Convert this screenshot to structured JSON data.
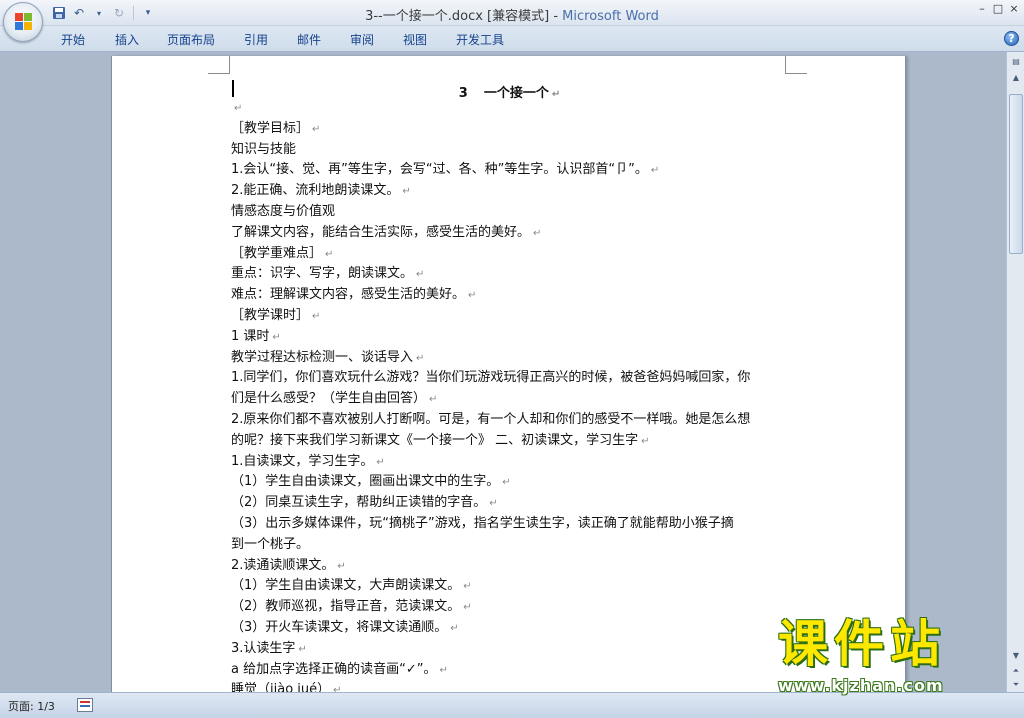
{
  "window": {
    "title_doc": "3--一个接一个.docx [兼容模式] -",
    "title_app": "Microsoft Word",
    "controls": [
      "–",
      "□",
      "×"
    ]
  },
  "quick_access": {
    "icons": [
      "save-icon",
      "undo-icon",
      "redo-icon",
      "customize-icon"
    ]
  },
  "ribbon": {
    "tabs": [
      "开始",
      "插入",
      "页面布局",
      "引用",
      "邮件",
      "审阅",
      "视图",
      "开发工具"
    ],
    "help": "?"
  },
  "document": {
    "title_num": "3",
    "title_text": "一个接一个",
    "pilcrow": "↵",
    "lines": [
      "",
      "［教学目标］",
      "知识与技能",
      "1.会认“接、觉、再”等生字，会写“过、各、种”等生字。认识部首“卩”。",
      "2.能正确、流利地朗读课文。",
      "情感态度与价值观",
      "了解课文内容，能结合生活实际，感受生活的美好。",
      "［教学重难点］",
      "重点：识字、写字，朗读课文。",
      "难点：理解课文内容，感受生活的美好。",
      "［教学课时］",
      "1 课时",
      "教学过程达标检测一、谈话导入",
      "1.同学们，你们喜欢玩什么游戏？当你们玩游戏玩得正高兴的时候，被爸爸妈妈喊回家，你",
      "们是什么感受？（学生自由回答）",
      "2.原来你们都不喜欢被别人打断啊。可是，有一个人却和你们的感受不一样哦。她是怎么想",
      "的呢？接下来我们学习新课文《一个接一个》 二、初读课文，学习生字",
      "1.自读课文，学习生字。",
      "（1）学生自由读课文，圈画出课文中的生字。",
      "（2）同桌互读生字，帮助纠正读错的字音。",
      "（3）出示多媒体课件，玩“摘桃子”游戏，指名学生读生字，读正确了就能帮助小猴子摘",
      "到一个桃子。",
      "2.读通读顺课文。",
      "（1）学生自由读课文，大声朗读课文。",
      "（2）教师巡视，指导正音，范读课文。",
      "（3）开火车读课文，将课文读通顺。",
      "3.认读生字",
      "a 给加点字选择正确的读音画“✓”。",
      "睡觉（jiào jué）"
    ],
    "line_end_marks": [
      true,
      true,
      false,
      true,
      true,
      false,
      true,
      true,
      true,
      true,
      true,
      true,
      true,
      false,
      true,
      false,
      true,
      true,
      true,
      true,
      false,
      false,
      true,
      true,
      true,
      true,
      true,
      true,
      true
    ]
  },
  "status": {
    "page": "页面: 1/3"
  },
  "watermark": {
    "big": "课件站",
    "url": "www.kjzhan.com"
  },
  "colors": {
    "ribbon_text": "#15428b",
    "app_title": "#4a6ea9",
    "watermark_yellow": "#ffe800",
    "watermark_green": "#2c6d14"
  }
}
